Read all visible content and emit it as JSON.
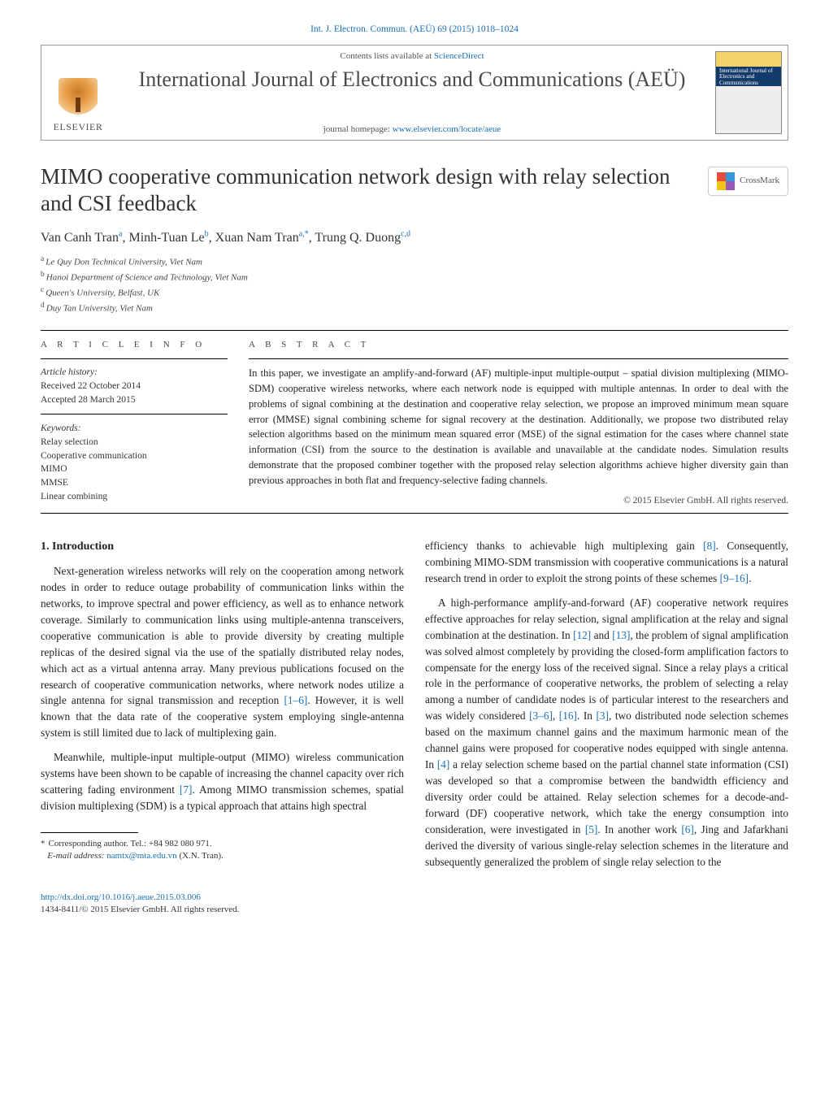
{
  "top_citation": "Int. J. Electron. Commun. (AEÜ) 69 (2015) 1018–1024",
  "banner": {
    "contents_prefix": "Contents lists available at ",
    "contents_link": "ScienceDirect",
    "journal_name": "International Journal of Electronics and Communications (AEÜ)",
    "homepage_prefix": "journal homepage: ",
    "homepage_link": "www.elsevier.com/locate/aeue",
    "publisher_logo_text": "ELSEVIER",
    "cover_title": "International Journal of Electronics and Communications"
  },
  "crossmark_label": "CrossMark",
  "title": "MIMO cooperative communication network design with relay selection and CSI feedback",
  "authors_line": "Van Canh Tran{a}, Minh-Tuan Le{b}, Xuan Nam Tran{a,*}, Trung Q. Duong{c,d}",
  "authors": [
    {
      "name": "Van Canh Tran",
      "marks": "a"
    },
    {
      "name": "Minh-Tuan Le",
      "marks": "b"
    },
    {
      "name": "Xuan Nam Tran",
      "marks": "a,*"
    },
    {
      "name": "Trung Q. Duong",
      "marks": "c,d"
    }
  ],
  "affiliations": [
    {
      "mark": "a",
      "text": "Le Quy Don Technical University, Viet Nam"
    },
    {
      "mark": "b",
      "text": "Hanoi Department of Science and Technology, Viet Nam"
    },
    {
      "mark": "c",
      "text": "Queen's University, Belfast, UK"
    },
    {
      "mark": "d",
      "text": "Duy Tan University, Viet Nam"
    }
  ],
  "article_info": {
    "heading": "a r t i c l e   i n f o",
    "history_label": "Article history:",
    "received": "Received 22 October 2014",
    "accepted": "Accepted 28 March 2015",
    "keywords_label": "Keywords:",
    "keywords": [
      "Relay selection",
      "Cooperative communication",
      "MIMO",
      "MMSE",
      "Linear combining"
    ]
  },
  "abstract": {
    "heading": "a b s t r a c t",
    "text": "In this paper, we investigate an amplify-and-forward (AF) multiple-input multiple-output – spatial division multiplexing (MIMO-SDM) cooperative wireless networks, where each network node is equipped with multiple antennas. In order to deal with the problems of signal combining at the destination and cooperative relay selection, we propose an improved minimum mean square error (MMSE) signal combining scheme for signal recovery at the destination. Additionally, we propose two distributed relay selection algorithms based on the minimum mean squared error (MSE) of the signal estimation for the cases where channel state information (CSI) from the source to the destination is available and unavailable at the candidate nodes. Simulation results demonstrate that the proposed combiner together with the proposed relay selection algorithms achieve higher diversity gain than previous approaches in both flat and frequency-selective fading channels.",
    "copyright": "© 2015 Elsevier GmbH. All rights reserved."
  },
  "section1_heading": "1. Introduction",
  "body_paragraphs": [
    "Next-generation wireless networks will rely on the cooperation among network nodes in order to reduce outage probability of communication links within the networks, to improve spectral and power efficiency, as well as to enhance network coverage. Similarly to communication links using multiple-antenna transceivers, cooperative communication is able to provide diversity by creating multiple replicas of the desired signal via the use of the spatially distributed relay nodes, which act as a virtual antenna array. Many previous publications focused on the research of cooperative communication networks, where network nodes utilize a single antenna for signal transmission and reception [1–6]. However, it is well known that the data rate of the cooperative system employing single-antenna system is still limited due to lack of multiplexing gain.",
    "Meanwhile, multiple-input multiple-output (MIMO) wireless communication systems have been shown to be capable of increasing the channel capacity over rich scattering fading environment [7]. Among MIMO transmission schemes, spatial division multiplexing (SDM) is a typical approach that attains high spectral",
    "efficiency thanks to achievable high multiplexing gain [8]. Consequently, combining MIMO-SDM transmission with cooperative communications is a natural research trend in order to exploit the strong points of these schemes [9–16].",
    "A high-performance amplify-and-forward (AF) cooperative network requires effective approaches for relay selection, signal amplification at the relay and signal combination at the destination. In [12] and [13], the problem of signal amplification was solved almost completely by providing the closed-form amplification factors to compensate for the energy loss of the received signal. Since a relay plays a critical role in the performance of cooperative networks, the problem of selecting a relay among a number of candidate nodes is of particular interest to the researchers and was widely considered [3–6], [16]. In [3], two distributed node selection schemes based on the maximum channel gains and the maximum harmonic mean of the channel gains were proposed for cooperative nodes equipped with single antenna. In [4] a relay selection scheme based on the partial channel state information (CSI) was developed so that a compromise between the bandwidth efficiency and diversity order could be attained. Relay selection schemes for a decode-and-forward (DF) cooperative network, which take the energy consumption into consideration, were investigated in [5]. In another work [6], Jing and Jafarkhani derived the diversity of various single-relay selection schemes in the literature and subsequently generalized the problem of single relay selection to the"
  ],
  "refs_map": {
    "r1_6": "[1–6]",
    "r7": "[7]",
    "r8": "[8]",
    "r9_16": "[9–16]",
    "r12": "[12]",
    "r13": "[13]",
    "r3_6": "[3–6]",
    "r16": "[16]",
    "r3": "[3]",
    "r4": "[4]",
    "r5": "[5]",
    "r6": "[6]"
  },
  "footnote": {
    "corr_label": "Corresponding author. Tel.: +84 982 080 971.",
    "email_label": "E-mail address: ",
    "email": "namtx@mta.edu.vn",
    "email_owner": " (X.N. Tran)."
  },
  "doi": {
    "url": "http://dx.doi.org/10.1016/j.aeue.2015.03.006",
    "issn_line": "1434-8411/© 2015 Elsevier GmbH. All rights reserved."
  }
}
